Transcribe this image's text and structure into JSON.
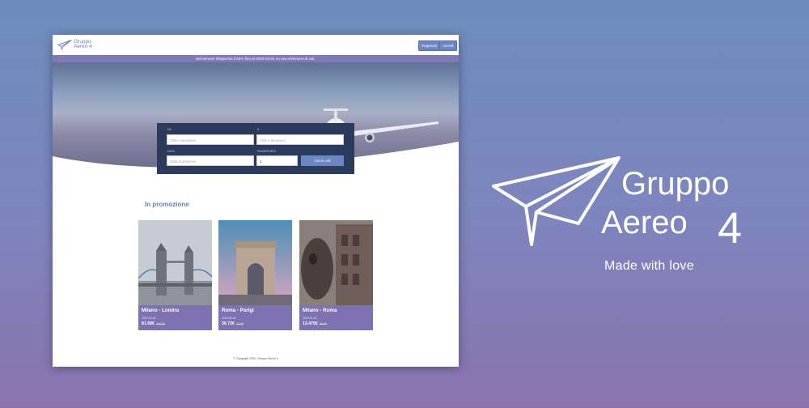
{
  "brand": {
    "line1": "Gruppo",
    "line2": "Aereo",
    "num": "4",
    "tagline": "Made with love"
  },
  "header": {
    "register": "Registrati",
    "login": "Accedi"
  },
  "promo_banner": "Benvenuto! Risparmia il 50% fino al 2020-04-01 su una selezione di voli.",
  "search": {
    "from_label": "DA",
    "from_placeholder": "Città o aeroporto",
    "to_label": "A",
    "to_placeholder": "Città o aeroporto",
    "date_label": "DATA",
    "date_placeholder": "Data di partenza",
    "pax_label": "PASSEGGERI",
    "pax_value": "1",
    "submit": "Cerca voli"
  },
  "promotions": {
    "title": "In promozione",
    "cards": [
      {
        "route": "Milano - Londra",
        "date": "2020-03-18",
        "price": "81.68€",
        "old_price": "163,36"
      },
      {
        "route": "Roma - Parigi",
        "date": "2020-06-09",
        "price": "36.72€",
        "old_price": "73,44"
      },
      {
        "route": "Milano - Roma",
        "date": "2020-04-18",
        "price": "13.475€",
        "old_price": "26,95"
      }
    ]
  },
  "footer": "© Copyright 2020. Gruppo Aereo 4",
  "colors": {
    "accent": "#6b86c2",
    "purple": "#7e72b3",
    "navy": "#2b3b5c"
  }
}
